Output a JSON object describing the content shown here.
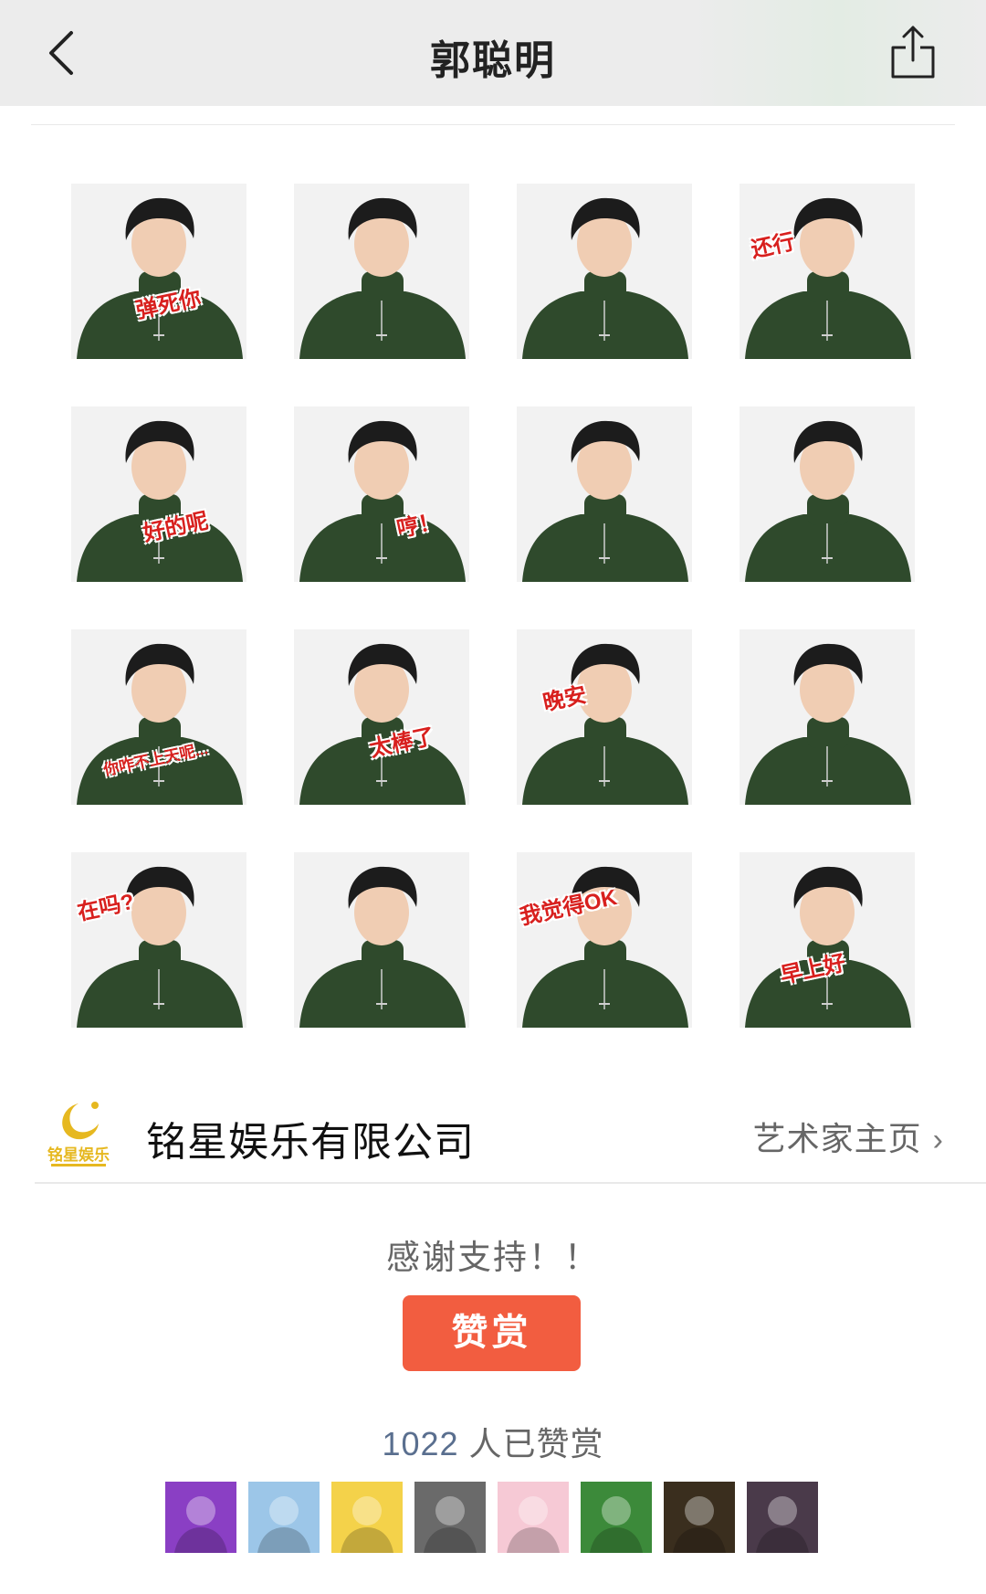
{
  "header": {
    "title": "郭聪明",
    "back_icon": "chevron-left-icon",
    "share_icon": "share-icon"
  },
  "stickers": [
    {
      "caption": "弹死你"
    },
    {
      "caption": ""
    },
    {
      "caption": ""
    },
    {
      "caption": "还行"
    },
    {
      "caption": "好的呢"
    },
    {
      "caption": "哼！"
    },
    {
      "caption": ""
    },
    {
      "caption": ""
    },
    {
      "caption": "你咋不上天呢..."
    },
    {
      "caption": "太棒了"
    },
    {
      "caption": "晚安"
    },
    {
      "caption": ""
    },
    {
      "caption": "在吗?"
    },
    {
      "caption": ""
    },
    {
      "caption": "我觉得OK"
    },
    {
      "caption": "早上好"
    }
  ],
  "company": {
    "logo_text": "铭星娱乐",
    "name": "铭星娱乐有限公司",
    "artist_link": "艺术家主页",
    "link_icon": "chevron-right-icon"
  },
  "reward": {
    "thanks_text": "感谢支持！！",
    "button_label": "赞赏",
    "count": "1022",
    "count_suffix": " 人已赞赏"
  },
  "avatars": [
    {
      "name": "avatar-purple-flower",
      "color": "#8a3fc4"
    },
    {
      "name": "avatar-cartoon-frog",
      "color": "#9cc6e8"
    },
    {
      "name": "avatar-boy-portrait",
      "color": "#f4d24a"
    },
    {
      "name": "avatar-basketball",
      "color": "#6a6a6a"
    },
    {
      "name": "avatar-anime-girl",
      "color": "#f6c9d5"
    },
    {
      "name": "avatar-children-group",
      "color": "#3c8a3a"
    },
    {
      "name": "avatar-girl-dark",
      "color": "#3a2e1e"
    },
    {
      "name": "avatar-boy-dark",
      "color": "#4a3a4a"
    }
  ],
  "colors": {
    "accent": "#f25d40",
    "sweater": "#2f4a2c",
    "hair": "#1c1c1c",
    "caption_red": "#d8201e"
  }
}
